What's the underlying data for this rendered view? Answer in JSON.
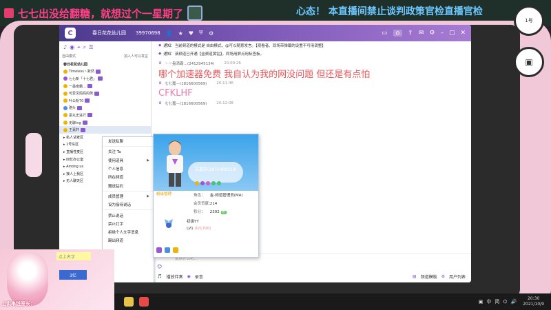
{
  "overlay": {
    "left_text": "七七出没给翻糖，就想过个一星期了",
    "right_text": "心态！ 本直播间禁止谈判政策官检直播官检"
  },
  "device": {
    "right_dot_top": "1号",
    "right_dot_mid": "▣"
  },
  "app": {
    "titlebar": {
      "logo": "C",
      "channel_name": "春日花花幼儿园",
      "channel_id": "39970698",
      "icons": [
        "people-icon",
        "star-icon",
        "heart-icon",
        "shield-icon",
        "gear-icon"
      ],
      "controls": [
        "vip-icon",
        "home-icon",
        "share-icon",
        "msg-icon",
        "settings-icon",
        "minimize-icon",
        "maximize-icon",
        "close-icon"
      ]
    },
    "sidebar": {
      "mode_label": "自由模式",
      "mode_right": "加入人可以发言",
      "root_channel": "春日花花幼儿园",
      "members": [
        {
          "name": "Timeless丶默然",
          "color": "u-gold"
        },
        {
          "name": "七七新「十七君」",
          "color": "u-purple"
        },
        {
          "name": "一墨南霸…",
          "color": "u-gold"
        },
        {
          "name": "可爱见妈妈的熊",
          "color": "u-gold"
        },
        {
          "name": "叶公粉70",
          "color": "u-gold"
        },
        {
          "name": "骆头",
          "color": "u-blue"
        },
        {
          "name": "恶丸史进行",
          "color": "u-gold"
        },
        {
          "name": "无聊ing",
          "color": "u-gold"
        },
        {
          "name": "王嘉轩",
          "color": "u-gold",
          "selected": true
        }
      ],
      "sub_channels": [
        "私人试麦区",
        "1号车区",
        "直播性麦区",
        "四长办公室",
        "Among us",
        "接人上我区",
        "无人聊天区"
      ]
    },
    "messages": {
      "notices": [
        "通知：当前频道的模式是 自由模式，@可以随意发言。【观看者、同场带弹幕的设置不可用调整】",
        "通知：该频道已开通【金频道黄钻】，同场用屏点用标签板。"
      ],
      "items": [
        {
          "user": "丶一盎滴霸…(2412945134)",
          "time": "20:09:26",
          "text": "哪个加速器免费  我自认为我的网没问题  但还是有点怕",
          "style": "red"
        },
        {
          "user": "七七嘉—(1816600569)",
          "time": "20:11:46",
          "text": "CFKLHF",
          "style": "pink"
        },
        {
          "user": "七七嘉—(1816600569)",
          "time": "20:12:08",
          "text": "",
          "style": "pink"
        }
      ]
    },
    "context_menu": {
      "items": [
        {
          "label": "发送私聊",
          "sub": false
        },
        {
          "label": "关注 Ta",
          "sub": false
        },
        {
          "label": "使用道具",
          "sub": true
        },
        {
          "label": "个人信息",
          "sub": false
        },
        {
          "label": "所在频道",
          "sub": false
        },
        {
          "label": "赠送钻石",
          "sub": false
        },
        {
          "label": "成员管理",
          "sub": true
        },
        {
          "label": "设为接待说话",
          "sub": false
        },
        {
          "label": "禁止说话",
          "sub": false
        },
        {
          "label": "禁止打字",
          "sub": false
        },
        {
          "label": "拒绝个人文字消息",
          "sub": false
        },
        {
          "label": "踢出频道",
          "sub": false
        }
      ]
    },
    "profile_card": {
      "name": "王嘉轩(1872469313)",
      "role_tag": "超级管理",
      "role_label": "角色：",
      "role_value": "金-频道管理员(MA)",
      "contrib_label": "会员贡献：",
      "contrib_value": "214",
      "points_label": "积分：",
      "points_value": "2392",
      "points_tag": "积",
      "rank_name": "初级YY",
      "level": "LV1",
      "level_progress": "(0/1700)"
    },
    "composer": {
      "placeholder": "说点什么吧…",
      "mic_label": "播放伴奏",
      "record_label": "录音",
      "mode_label": "频道模板",
      "other_label": "用户列表"
    }
  },
  "cam": {
    "box_text": "点上名字",
    "vol_text": "3亿",
    "label": "上供串钱室长："
  },
  "taskbar": {
    "tray_icons": [
      "show-desktop-icon",
      "input-ime",
      "volume-icon",
      "network-icon"
    ],
    "ime_label": "中",
    "ime2": "简",
    "time": "20:30",
    "date": "2021/10/9"
  }
}
